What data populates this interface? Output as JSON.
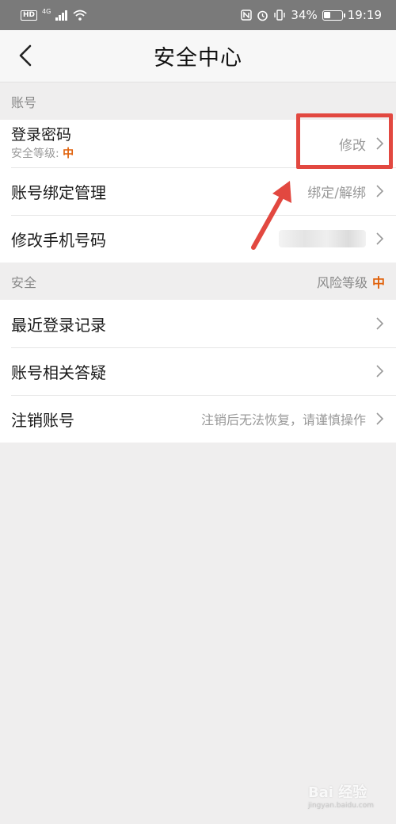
{
  "status_bar": {
    "hd": "HD",
    "network": "4G",
    "battery": "34%",
    "time": "19:19"
  },
  "header": {
    "title": "安全中心"
  },
  "account_section": {
    "label": "账号",
    "items": [
      {
        "title": "登录密码",
        "sub_prefix": "安全等级:",
        "sub_level": "中",
        "value": "修改"
      },
      {
        "title": "账号绑定管理",
        "value": "绑定/解绑"
      },
      {
        "title": "修改手机号码",
        "value": ""
      }
    ]
  },
  "security_section": {
    "label": "安全",
    "risk_label": "风险等级",
    "risk_level": "中",
    "items": [
      {
        "title": "最近登录记录",
        "value": ""
      },
      {
        "title": "账号相关答疑",
        "value": ""
      },
      {
        "title": "注销账号",
        "value": "注销后无法恢复，请谨慎操作"
      }
    ]
  },
  "watermark": {
    "brand": "Bai 经验",
    "url": "jingyan.baidu.com"
  },
  "colors": {
    "accent": "#e0620c",
    "annotation": "#e24840"
  }
}
